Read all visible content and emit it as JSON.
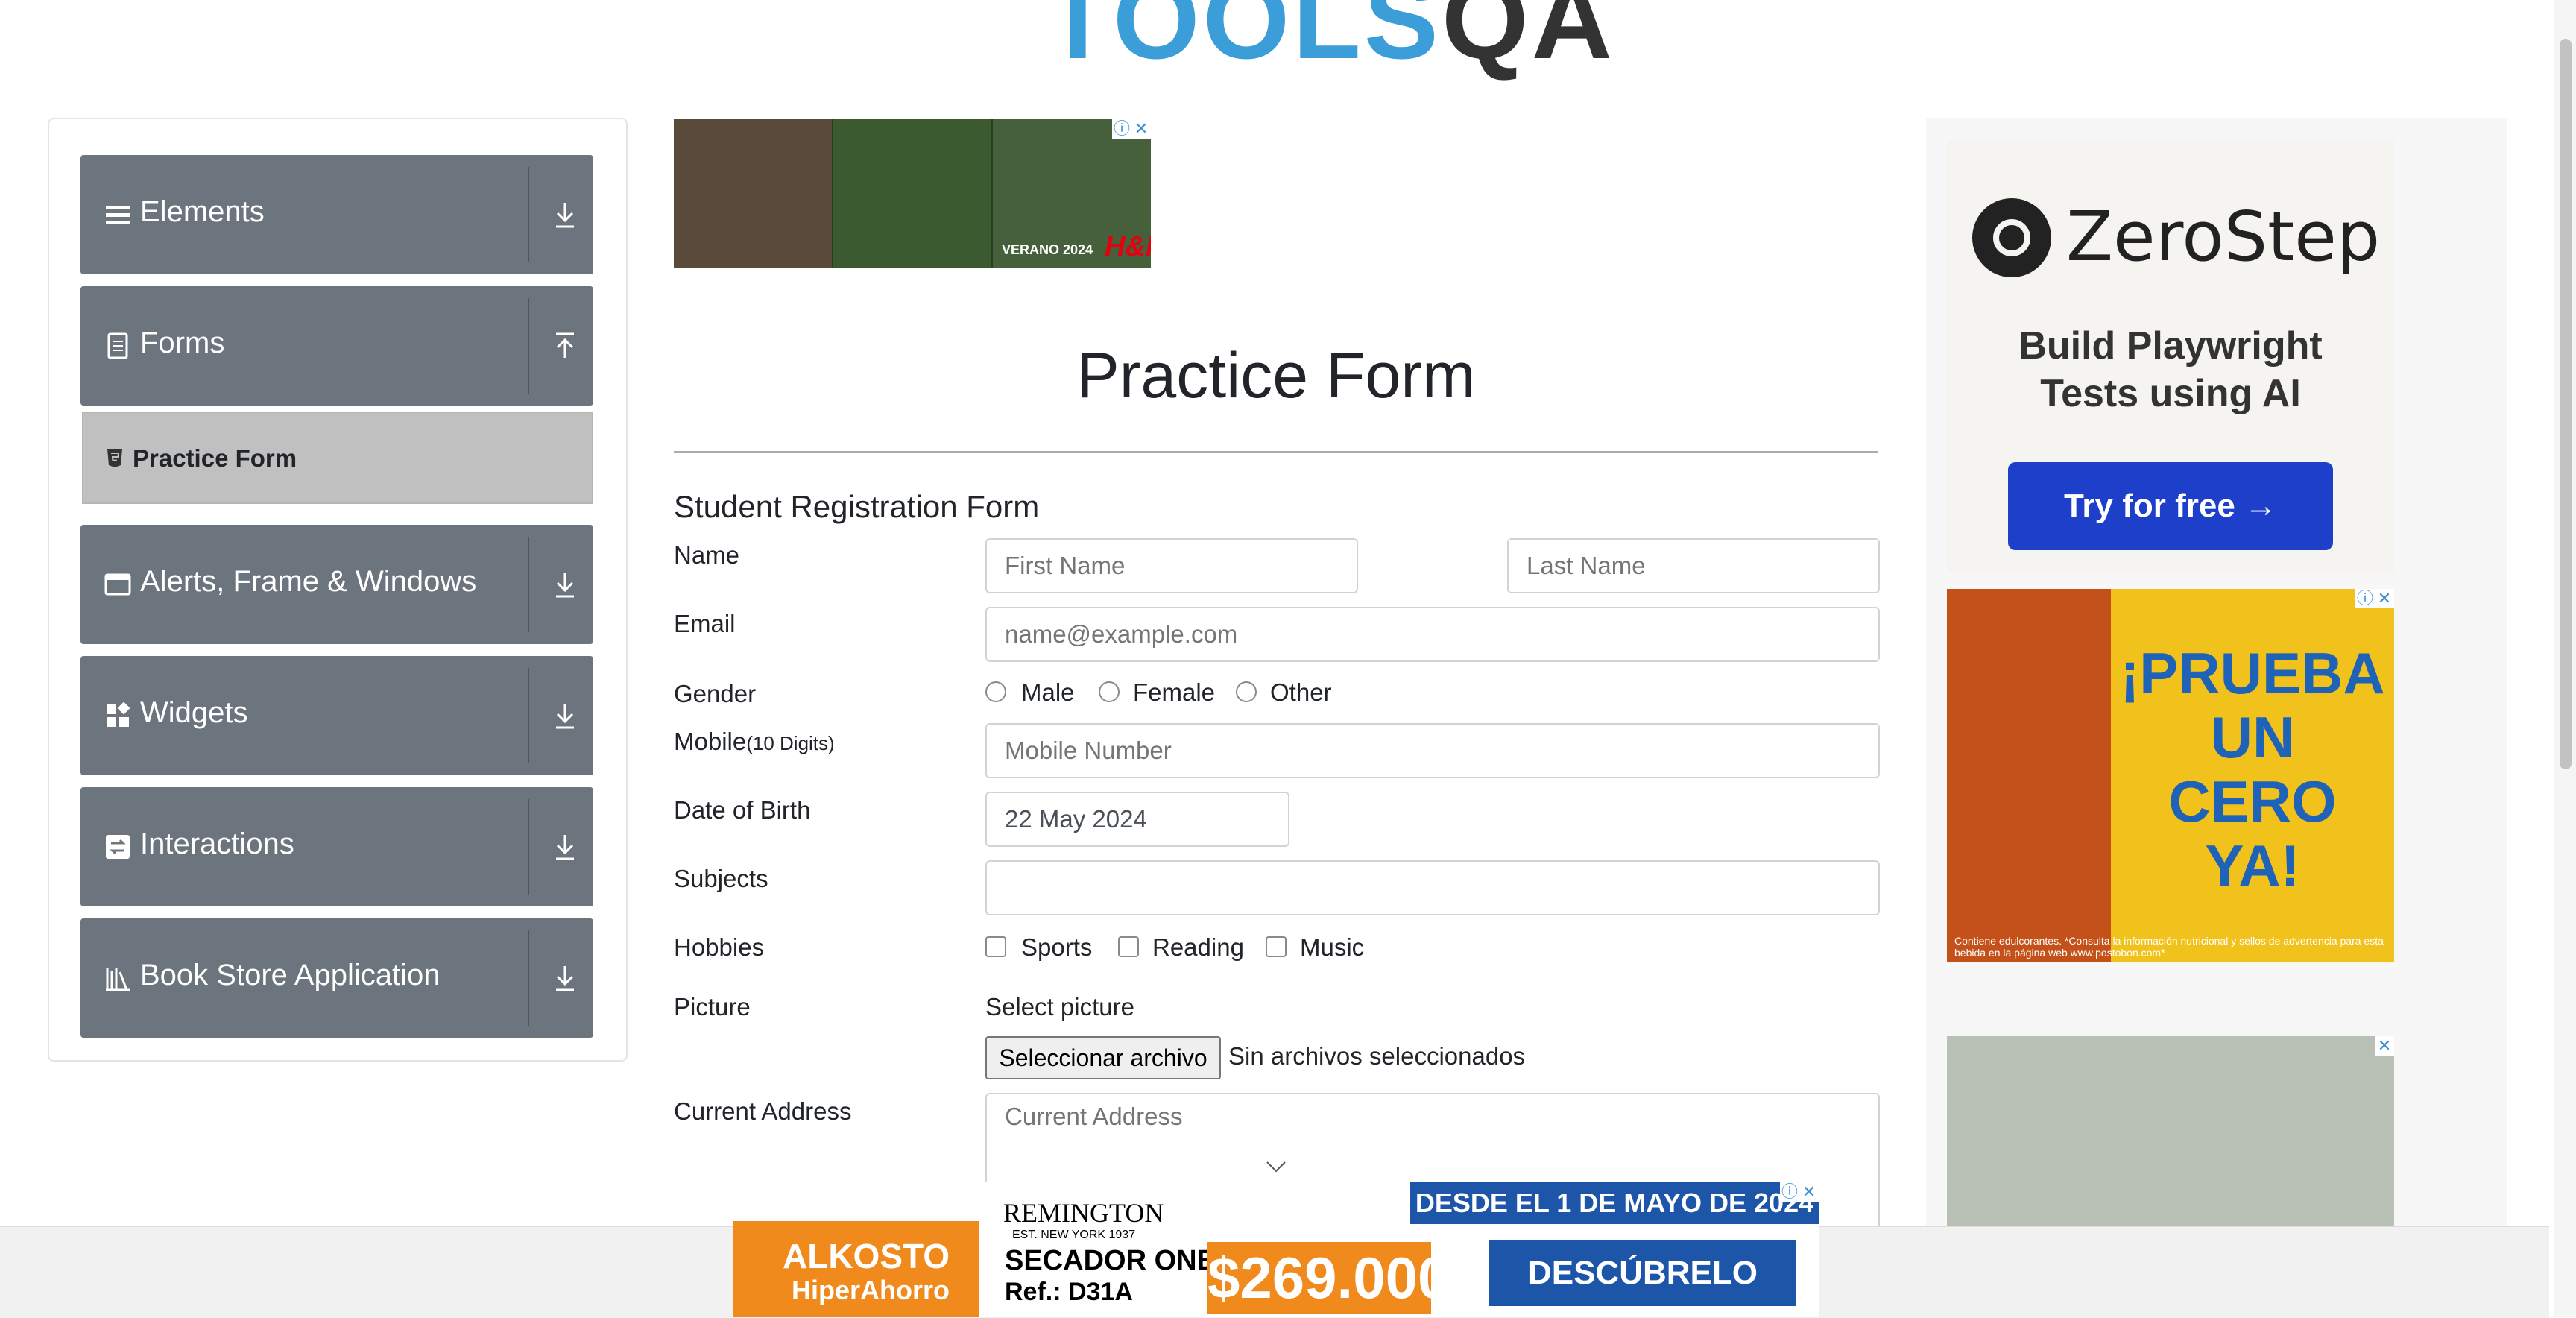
{
  "logo": {
    "part1": "TOOLS",
    "part2": "QA"
  },
  "sidebar": {
    "groups": [
      {
        "label": "Elements",
        "icon": "menu-icon",
        "expanded": false
      },
      {
        "label": "Forms",
        "icon": "form-icon",
        "expanded": true,
        "items": [
          {
            "label": "Practice Form",
            "icon": "html-icon",
            "active": true
          }
        ]
      },
      {
        "label": "Alerts, Frame & Windows",
        "icon": "window-icon",
        "expanded": false
      },
      {
        "label": "Widgets",
        "icon": "widgets-icon",
        "expanded": false
      },
      {
        "label": "Interactions",
        "icon": "interactions-icon",
        "expanded": false
      },
      {
        "label": "Book Store Application",
        "icon": "library-icon",
        "expanded": false
      }
    ],
    "colors": {
      "group_bg": "#6c757d",
      "active_bg": "#c0c0c0"
    }
  },
  "main": {
    "page_title": "Practice Form",
    "form_title": "Student Registration Form",
    "name": {
      "label": "Name",
      "first_placeholder": "First Name",
      "last_placeholder": "Last Name"
    },
    "email": {
      "label": "Email",
      "placeholder": "name@example.com"
    },
    "gender": {
      "label": "Gender",
      "options": [
        "Male",
        "Female",
        "Other"
      ]
    },
    "mobile": {
      "label": "Mobile",
      "label_suffix": "(10 Digits)",
      "placeholder": "Mobile Number"
    },
    "dob": {
      "label": "Date of Birth",
      "value": "22 May 2024"
    },
    "subjects": {
      "label": "Subjects",
      "value": ""
    },
    "hobbies": {
      "label": "Hobbies",
      "options": [
        "Sports",
        "Reading",
        "Music"
      ]
    },
    "picture": {
      "label": "Picture",
      "prompt": "Select picture",
      "button": "Seleccionar archivo",
      "status": "Sin archivos seleccionados"
    },
    "address": {
      "label": "Current Address",
      "placeholder": "Current Address"
    }
  },
  "ads": {
    "top": {
      "tag": "VERANO 2024",
      "brand": "H&M"
    },
    "zerostep": {
      "name": "ZeroStep",
      "tagline1": "Build Playwright",
      "tagline2": "Tests using AI",
      "cta": "Try for free →"
    },
    "fuze": {
      "headline1": "¡PRUEBA UN",
      "headline2": "CERO",
      "headline3": "YA!",
      "fine": "Contiene edulcorantes. *Consulta la información nutricional y sellos de advertencia para esta bebida en la página web www.postobon.com*"
    },
    "bottom": {
      "store1": "ALKOSTO",
      "store2": "HiperAhorro",
      "brand": "REMINGTON",
      "est": "EST. NEW YORK 1937",
      "product1": "SECADOR ONE",
      "product2": "Ref.: D31A",
      "price": "$269.000",
      "date": "DESDE EL 1 DE MAYO DE 2024",
      "cta": "DESCÚBRELO AQUÍ"
    }
  }
}
